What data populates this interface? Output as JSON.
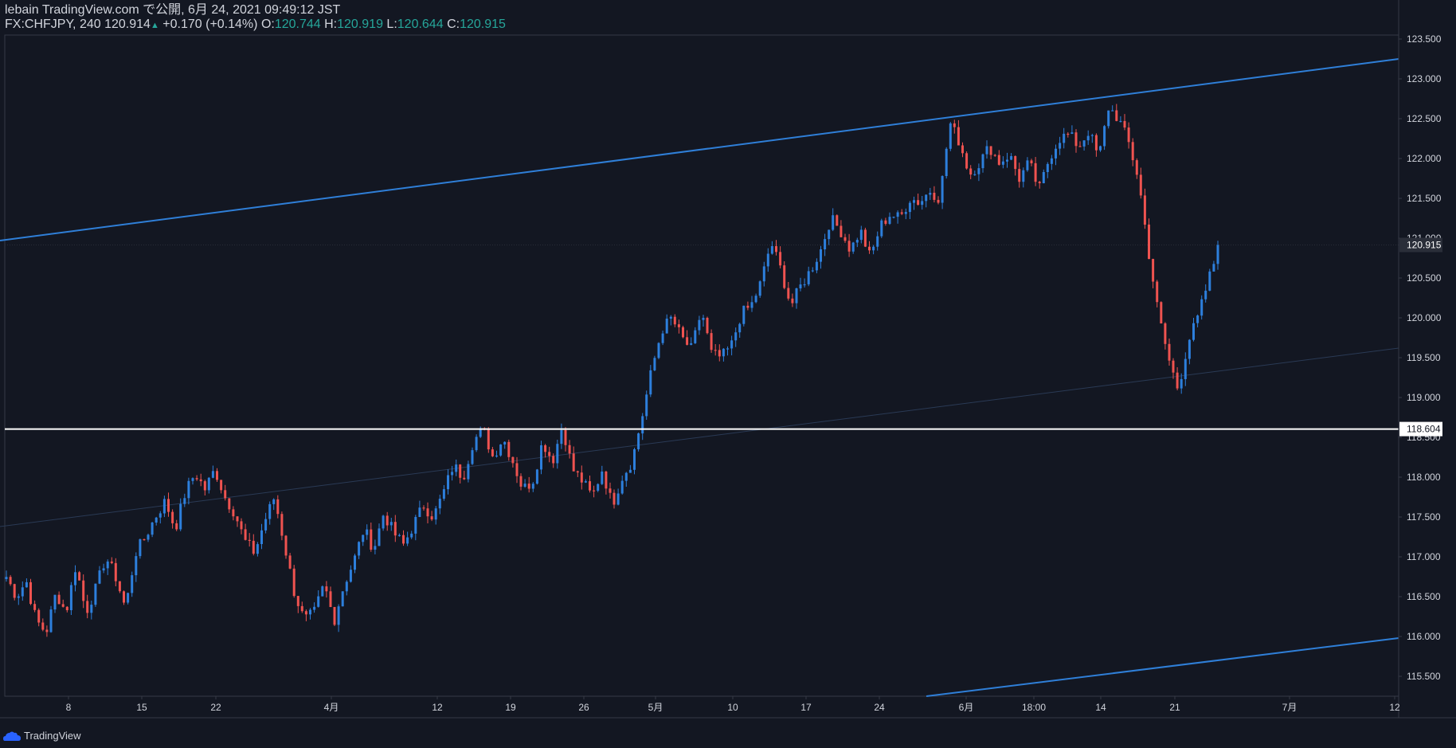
{
  "header": {
    "published": "lebain TradingView.com で公開, 6月 24, 2021 09:49:12 JST",
    "symbol": "FX:CHFJPY, 240",
    "last": "120.914",
    "change": "+0.170 (+0.14%)",
    "open_label": "O:",
    "open": "120.744",
    "high_label": "H:",
    "high": "120.919",
    "low_label": "L:",
    "low": "120.644",
    "close_label": "C:",
    "close": "120.915"
  },
  "footer": {
    "brand": "TradingView"
  },
  "colors": {
    "bg": "#131722",
    "up": "#2d7fdc",
    "down": "#ef5350",
    "grid": "#363a45",
    "text": "#d1d4dc",
    "accent": "#26a69a",
    "trend": "#2f7fd8",
    "hline": "#ffffff"
  },
  "chart_data": {
    "type": "candlestick",
    "y_ticks": [
      "115.500",
      "116.000",
      "116.500",
      "117.000",
      "117.500",
      "118.000",
      "118.500",
      "119.000",
      "119.500",
      "120.000",
      "120.500",
      "121.000",
      "121.500",
      "122.000",
      "122.500",
      "123.000",
      "123.500"
    ],
    "ylim": [
      115.25,
      123.55
    ],
    "x_ticks": [
      "8",
      "15",
      "22",
      "4月",
      "12",
      "19",
      "26",
      "5月",
      "10",
      "17",
      "24",
      "6月",
      "18:00",
      "14",
      "21",
      "7月",
      "12"
    ],
    "last_price_label": "120.915",
    "last_price": 120.915,
    "hline_label": "118.604",
    "hline": 118.604,
    "price_path": [
      116.75,
      116.5,
      116.7,
      116.2,
      116.05,
      116.55,
      116.3,
      116.9,
      116.3,
      116.6,
      117.0,
      116.75,
      116.35,
      117.05,
      117.25,
      117.5,
      117.7,
      117.35,
      117.8,
      118.05,
      117.85,
      118.1,
      117.75,
      117.55,
      117.2,
      117.05,
      117.45,
      117.75,
      117.15,
      116.55,
      116.2,
      116.3,
      116.65,
      116.2,
      116.65,
      116.95,
      117.35,
      117.1,
      117.55,
      117.3,
      117.15,
      117.4,
      117.65,
      117.5,
      117.8,
      118.15,
      118.0,
      118.45,
      118.6,
      118.25,
      118.5,
      118.2,
      117.85,
      117.95,
      118.45,
      118.2,
      118.65,
      118.1,
      117.95,
      117.75,
      118.1,
      117.65,
      118.0,
      118.2,
      118.75,
      119.35,
      119.85,
      120.0,
      119.75,
      119.6,
      120.1,
      119.55,
      119.5,
      119.65,
      120.05,
      120.15,
      120.45,
      120.95,
      120.6,
      120.15,
      120.4,
      120.6,
      120.85,
      121.25,
      121.1,
      120.85,
      121.1,
      120.75,
      121.15,
      121.3,
      121.25,
      121.5,
      121.45,
      121.6,
      121.5,
      122.45,
      122.2,
      121.8,
      121.95,
      122.15,
      121.95,
      122.05,
      121.75,
      121.95,
      121.6,
      122.0,
      122.25,
      122.3,
      122.15,
      122.35,
      122.0,
      122.65,
      122.5,
      122.2,
      121.75,
      120.85,
      120.05,
      119.5,
      119.1,
      119.7,
      120.0,
      120.45,
      120.85
    ]
  }
}
